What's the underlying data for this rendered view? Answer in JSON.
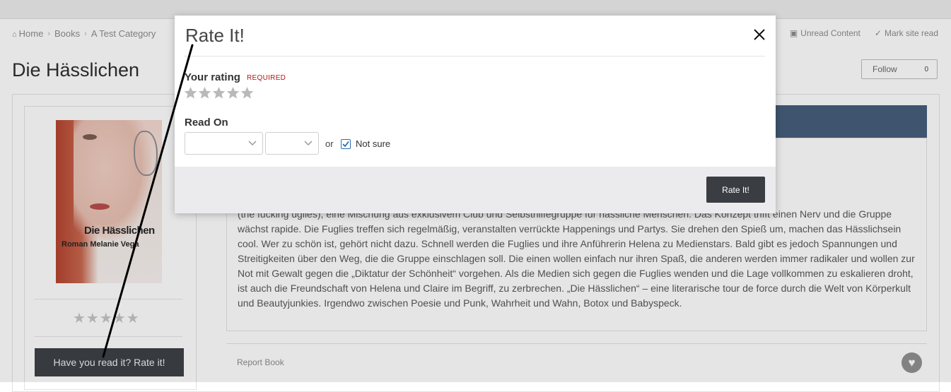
{
  "breadcrumb": {
    "items": [
      "Home",
      "Books",
      "A Test Category"
    ],
    "separator": "›"
  },
  "top_links": {
    "unread": "Unread Content",
    "mark_read": "Mark site read"
  },
  "page": {
    "title": "Die Hässlichen",
    "follow_label": "Follow",
    "follow_count": "0"
  },
  "book": {
    "cover_title": "Die Hässlichen",
    "cover_author": "Melanie Vega",
    "cover_subtitle": "Roman",
    "rate_cta": "Have you read it? Rate it!",
    "stars_total": 5,
    "stars_filled": 0
  },
  "description": {
    "text": "…wurde. Rumjammern?\n…men. Sie gründen die Fuglies\n(the fucking uglies), eine Mischung aus exklusivem Club und Selbsthilfegruppe für hässliche Menschen. Das Konzept trifft einen Nerv und die Gruppe\nwächst rapide. Die Fuglies treffen sich regelmäßig, veranstalten verrückte Happenings und Partys. Sie drehen den Spieß um, machen das Hässlichsein\ncool. Wer zu schön ist, gehört nicht dazu. Schnell werden die Fuglies und ihre Anführerin Helena zu Medienstars. Bald gibt es jedoch Spannungen und\nStreitigkeiten über den Weg, die die Gruppe einschlagen soll. Die einen wollen einfach nur ihren Spaß, die anderen werden immer radikaler und wollen zur\nNot mit Gewalt gegen die „Diktatur der Schönheit“ vorgehen. Als die Medien sich gegen die Fuglies wenden und die Lage vollkommen zu eskalieren droht,\nist auch die Freundschaft von Helena und Claire im Begriff, zu zerbrechen. „Die Hässlichen“ – eine literarische tour de force durch die Welt von Körperkult\nund Beautyjunkies. Irgendwo zwischen Poesie und Punk, Wahrheit und Wahn, Botox und Babyspeck.",
    "report_label": "Report Book"
  },
  "modal": {
    "title": "Rate It!",
    "rating_label": "Your rating",
    "required_label": "REQUIRED",
    "stars_total": 5,
    "stars_selected": 0,
    "read_on_label": "Read On",
    "month_value": "",
    "year_value": "",
    "or_label": "or",
    "not_sure_label": "Not sure",
    "not_sure_checked": true,
    "submit_label": "Rate It!"
  },
  "colors": {
    "star_empty": "#b9b9b9",
    "button_dark": "#3a3d42",
    "header_blue": "#435a78",
    "required_red": "#b01818",
    "checkbox_blue": "#2e6fb0"
  },
  "icons": {
    "home": "home-icon",
    "close": "close-icon",
    "star": "star-icon",
    "chevron": "chevron-down-icon",
    "check": "check-icon",
    "heart": "heart-icon"
  }
}
